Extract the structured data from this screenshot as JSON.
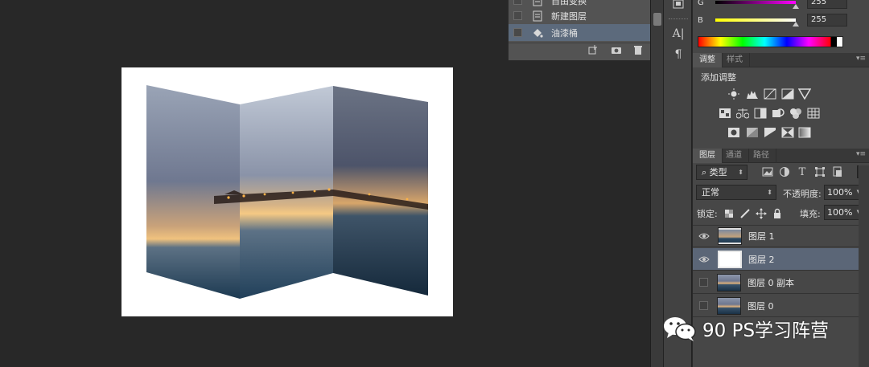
{
  "history": {
    "items": [
      {
        "label": "自由变换",
        "icon": "document-icon",
        "selected": false
      },
      {
        "label": "新建图层",
        "icon": "document-icon",
        "selected": false
      },
      {
        "label": "油漆桶",
        "icon": "paint-bucket-icon",
        "selected": true
      }
    ],
    "buttons": [
      "new-document-from-state-icon",
      "snapshot-camera-icon",
      "trash-icon"
    ]
  },
  "color": {
    "rows": [
      {
        "label": "G",
        "value": "255",
        "gradient": [
          "#000000",
          "#ff00ff"
        ]
      },
      {
        "label": "B",
        "value": "255",
        "gradient": [
          "#ffff00",
          "#ffffff"
        ]
      }
    ]
  },
  "adjustments": {
    "tabs": [
      "调整",
      "样式"
    ],
    "active_tab": 0,
    "title": "添加调整",
    "icons": [
      [
        "brightness-icon",
        "levels-icon",
        "curves-icon",
        "exposure-icon",
        "vibrance-icon"
      ],
      [
        "hue-saturation-icon",
        "color-balance-icon",
        "black-white-icon",
        "photo-filter-icon",
        "channel-mixer-icon",
        "color-lookup-icon"
      ],
      [
        "invert-icon",
        "posterize-icon",
        "threshold-icon",
        "selective-color-icon",
        "gradient-map-icon"
      ]
    ]
  },
  "layers_panel": {
    "tabs": [
      "图层",
      "通道",
      "路径"
    ],
    "active_tab": 0,
    "filter_kind": "类型",
    "blend_mode": "正常",
    "opacity_label": "不透明度:",
    "opacity_value": "100%",
    "lock_label": "锁定:",
    "fill_label": "填充:",
    "fill_value": "100%",
    "layers": [
      {
        "name": "图层 1",
        "visible": true,
        "selected": false,
        "thumb": "folded-photo"
      },
      {
        "name": "图层 2",
        "visible": true,
        "selected": true,
        "thumb": "white"
      },
      {
        "name": "图层 0 副本",
        "visible": false,
        "selected": false,
        "thumb": "photo"
      },
      {
        "name": "图层 0",
        "visible": false,
        "selected": false,
        "thumb": "photo"
      }
    ]
  },
  "tools": [
    "color-swatch-icon",
    "character-icon",
    "paragraph-icon"
  ],
  "watermark": {
    "text": "90 PS学习阵营",
    "icon": "wechat-icon"
  },
  "colors": {
    "selection": "#5b6677",
    "panel_bg": "#474747",
    "workspace_bg": "#282828"
  }
}
